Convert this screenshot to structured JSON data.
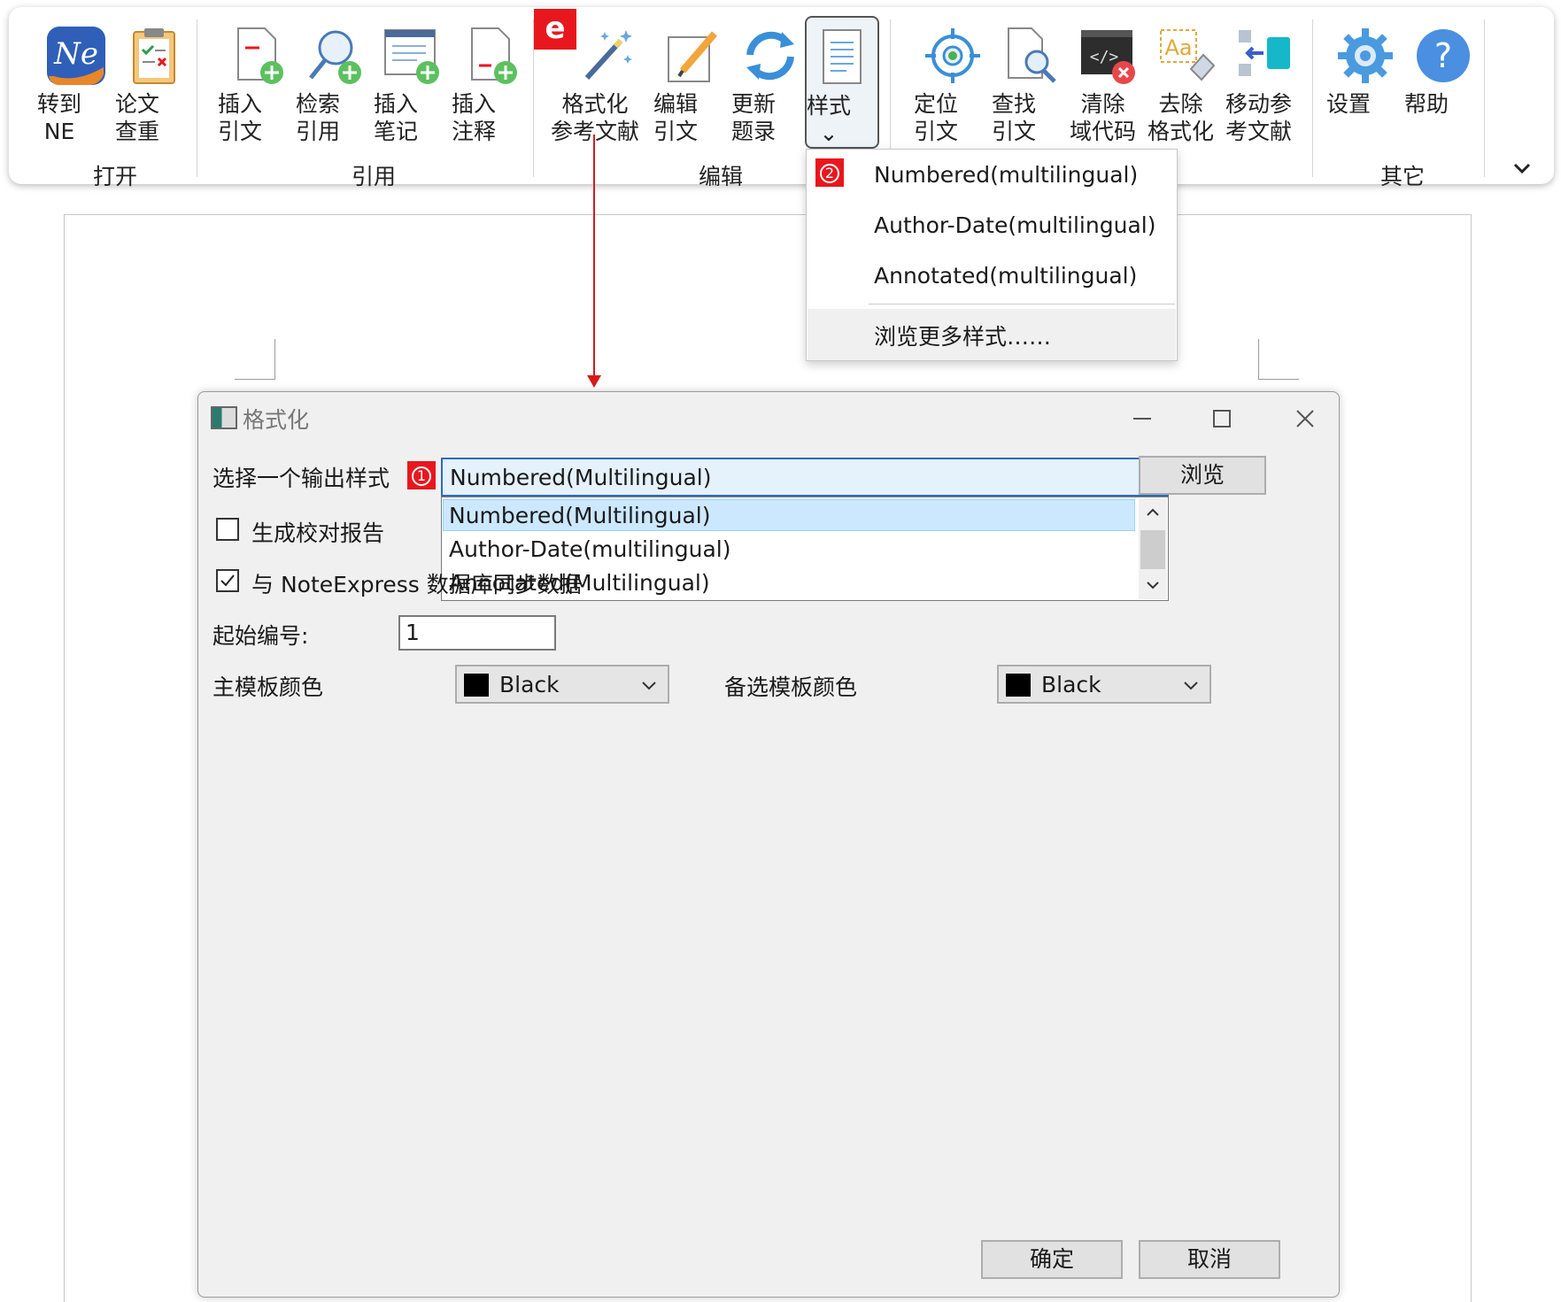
{
  "ribbon": {
    "annotation_marker": "e",
    "buttons": [
      {
        "id": "goto-ne",
        "label": "转到\nNE",
        "icon": "noteexpress-logo-icon"
      },
      {
        "id": "paper-check",
        "label": "论文\n查重",
        "icon": "clipboard-check-icon"
      },
      {
        "id": "insert-citation",
        "label": "插入\n引文",
        "icon": "doc-add-icon"
      },
      {
        "id": "search-citation",
        "label": "检索\n引用",
        "icon": "search-add-icon"
      },
      {
        "id": "insert-note",
        "label": "插入\n笔记",
        "icon": "note-add-icon"
      },
      {
        "id": "insert-annotation",
        "label": "插入\n注释",
        "icon": "annotation-add-icon"
      },
      {
        "id": "format-bibliography",
        "label": "格式化\n参考文献",
        "icon": "magic-wand-icon"
      },
      {
        "id": "edit-citation",
        "label": "编辑\n引文",
        "icon": "pencil-edit-icon"
      },
      {
        "id": "update-bibliography",
        "label": "更新\n题录",
        "icon": "refresh-icon"
      },
      {
        "id": "style",
        "label": "样式\n⌄",
        "icon": "style-doc-icon"
      },
      {
        "id": "locate-citation",
        "label": "定位\n引文",
        "icon": "target-icon"
      },
      {
        "id": "find-citation",
        "label": "查找\n引文",
        "icon": "find-doc-icon"
      },
      {
        "id": "clear-field-codes",
        "label": "清除\n域代码",
        "icon": "clear-code-icon"
      },
      {
        "id": "remove-formatting",
        "label": "去除\n格式化",
        "icon": "eraser-icon"
      },
      {
        "id": "move-bibliography",
        "label": "移动参\n考文献",
        "icon": "move-blocks-icon"
      },
      {
        "id": "settings",
        "label": "设置",
        "icon": "gear-icon"
      },
      {
        "id": "help",
        "label": "帮助",
        "icon": "help-icon"
      }
    ],
    "groups": {
      "open": "打开",
      "cite": "引用",
      "edit": "编辑",
      "other": "其它"
    }
  },
  "style_menu": {
    "marker": "2",
    "items": [
      "Numbered(multilingual)",
      "Author-Date(multilingual)",
      "Annotated(multilingual)"
    ],
    "browse_more": "浏览更多样式……"
  },
  "dialog": {
    "title": "格式化",
    "select_style_label": "选择一个输出样式",
    "marker": "1",
    "selected_style": "Numbered(Multilingual)",
    "browse_button": "浏览",
    "style_options": [
      "Numbered(Multilingual)",
      "Author-Date(multilingual)",
      "Annotated(Multilingual)"
    ],
    "generate_report_label": "生成校对报告",
    "generate_report_checked": false,
    "sync_label": "与 NoteExpress 数据库同步数据",
    "sync_checked": true,
    "start_number_label": "起始编号:",
    "start_number_value": "1",
    "main_template_color_label": "主模板颜色",
    "main_template_color": "Black",
    "alt_template_color_label": "备选模板颜色",
    "alt_template_color": "Black",
    "ok_button": "确定",
    "cancel_button": "取消"
  },
  "colors": {
    "accent_red": "#e8171e",
    "focus_blue": "#2d6bbd",
    "selection_blue": "#cce8ff"
  }
}
